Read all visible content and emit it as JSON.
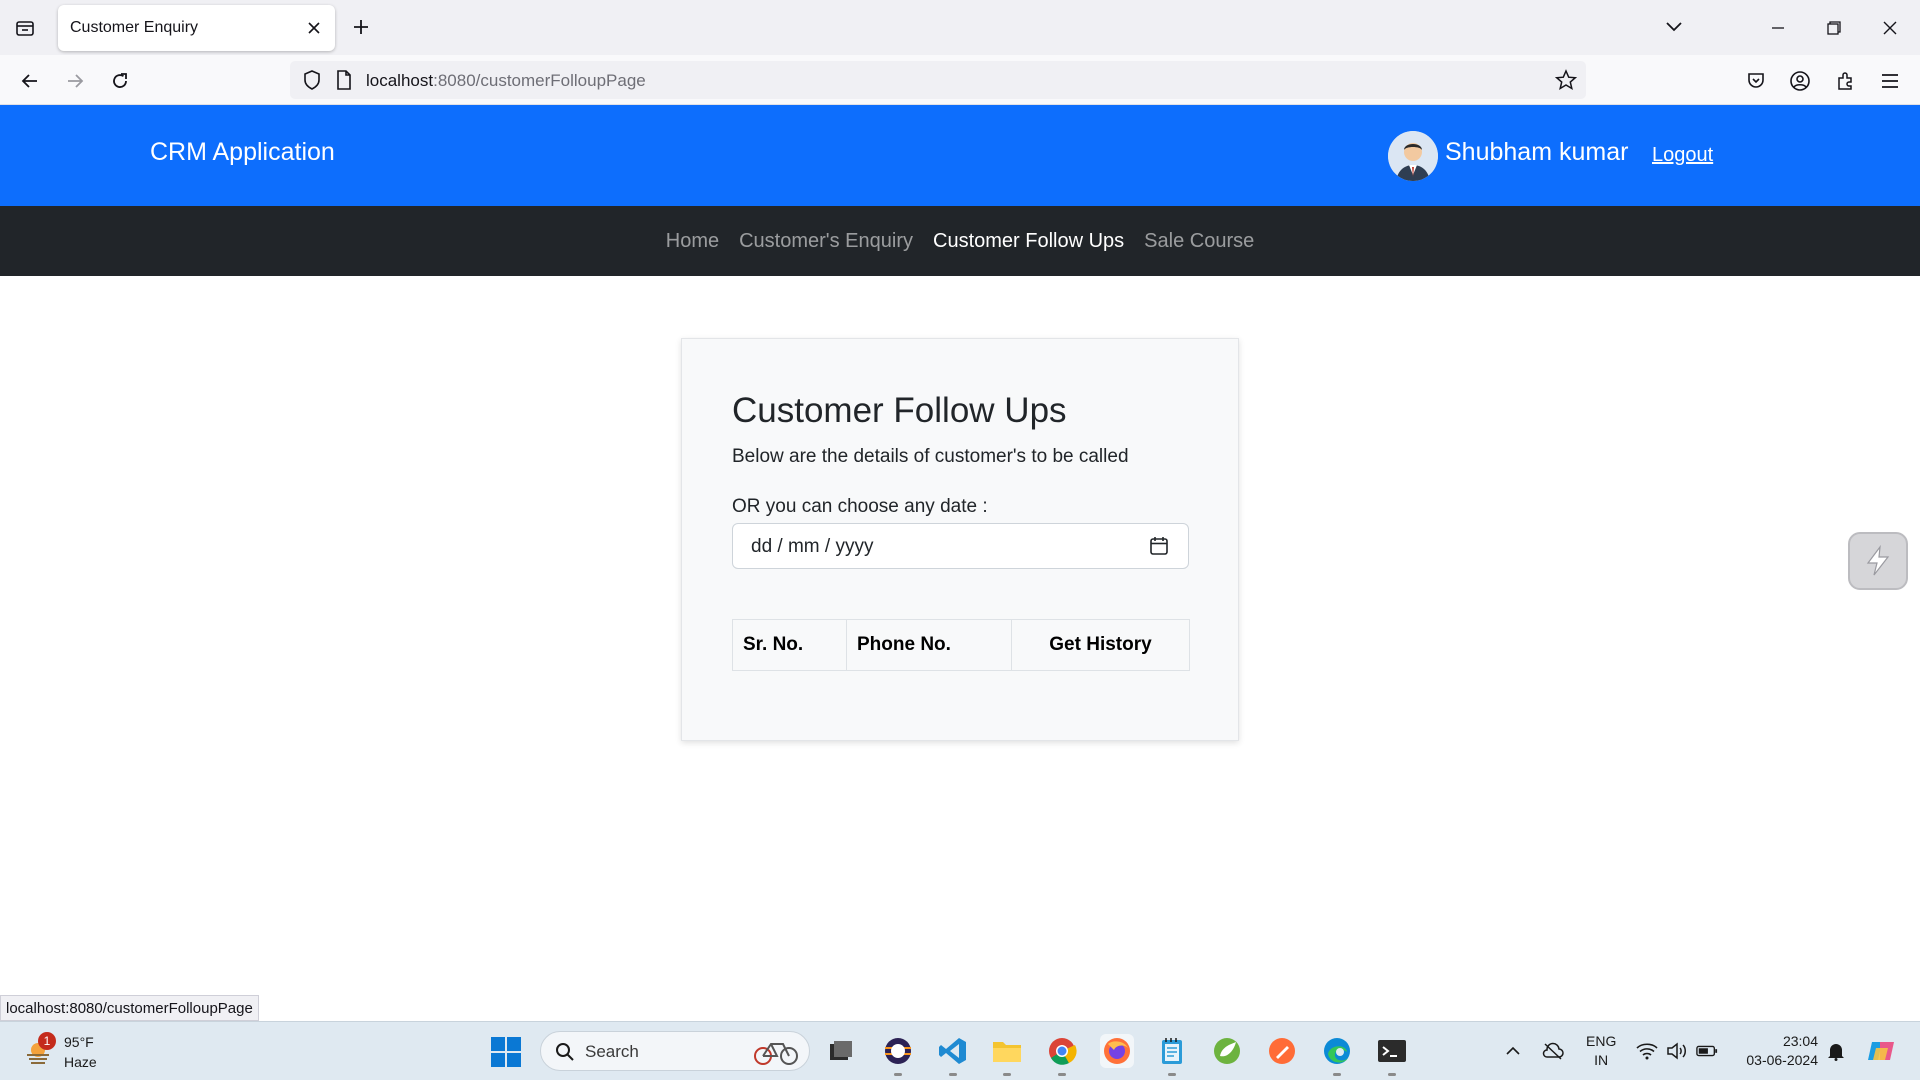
{
  "browser": {
    "tab_title": "Customer Enquiry",
    "url_host": "localhost",
    "url_rest": ":8080/customerFolloupPage",
    "status_url": "localhost:8080/customerFolloupPage"
  },
  "header": {
    "brand": "CRM Application",
    "username": "Shubham kumar",
    "logout_label": "Logout"
  },
  "nav": {
    "items": [
      {
        "label": "Home"
      },
      {
        "label": "Customer's Enquiry"
      },
      {
        "label": "Customer Follow Ups"
      },
      {
        "label": "Sale Course"
      }
    ],
    "active_index": 2
  },
  "card": {
    "title": "Customer Follow Ups",
    "subtitle": "Below are the details of customer's to be called",
    "date_label": "OR you can choose any date :",
    "date_placeholder": "dd / mm / yyyy",
    "table_headers": [
      "Sr. No.",
      "Phone No.",
      "Get History"
    ]
  },
  "taskbar": {
    "weather_badge": "1",
    "weather_temp": "95°F",
    "weather_cond": "Haze",
    "search_label": "Search",
    "lang_top": "ENG",
    "lang_bottom": "IN",
    "time": "23:04",
    "date": "03-06-2024"
  },
  "colors": {
    "header_bg": "#0d6efd",
    "nav_bg": "#212529",
    "card_bg": "#f8f9fa"
  }
}
